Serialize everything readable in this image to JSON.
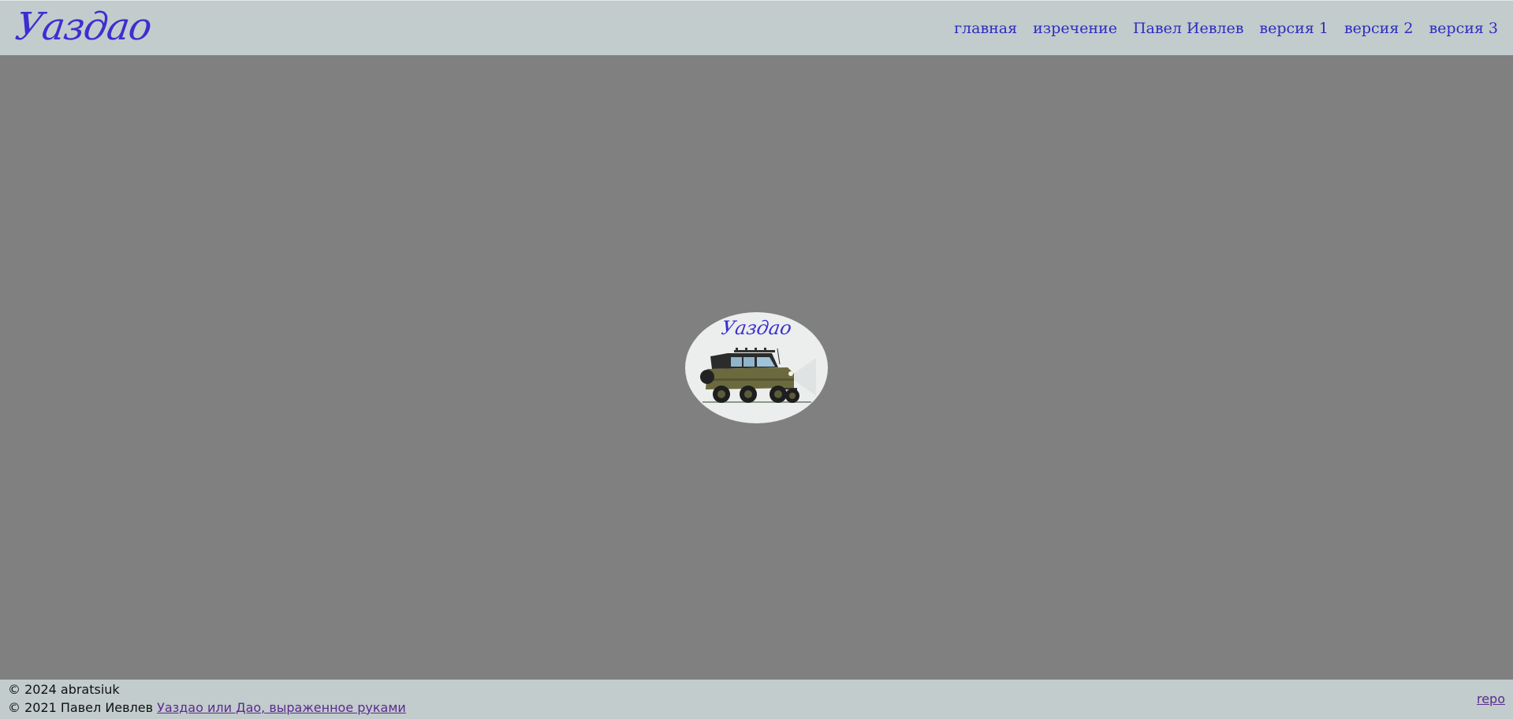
{
  "header": {
    "logo_text": "Уаздао",
    "nav": [
      {
        "label": "главная"
      },
      {
        "label": "изречение"
      },
      {
        "label": "Павел Иевлев"
      },
      {
        "label": "версия 1"
      },
      {
        "label": "версия 2"
      },
      {
        "label": "версия 3"
      }
    ]
  },
  "main": {
    "badge_title": "Уаздао",
    "badge_image": "uaz-car-illustration"
  },
  "footer": {
    "copyright_2024": "© 2024 abratsiuk",
    "copyright_2021_prefix": "© 2021 Павел Иевлев",
    "book_link": "Уаздао или Дао, выраженное руками",
    "repo_link": "repo"
  },
  "colors": {
    "header_bg": "#c2cccc",
    "page_bg": "#808080",
    "logo": "#3b2fd0",
    "nav_link": "#2d2dc0",
    "footer_link": "#5a2b8f"
  }
}
